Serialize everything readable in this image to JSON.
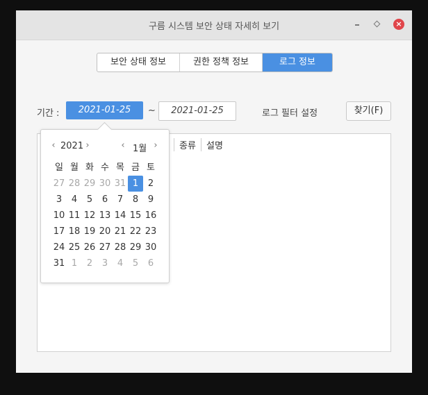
{
  "window": {
    "title": "구름 시스템 보안 상태 자세히 보기",
    "close_glyph": "×"
  },
  "tabs": [
    {
      "label": "보안 상태 정보",
      "active": false
    },
    {
      "label": "권한 정책 정보",
      "active": false
    },
    {
      "label": "로그 정보",
      "active": true
    }
  ],
  "filter": {
    "period_label": "기간 :",
    "start_date": "2021-01-25",
    "separator": "~",
    "end_date": "2021-01-25",
    "log_filter_label": "로그 필터 설정",
    "find_button": "찾기(F)"
  },
  "table": {
    "columns": [
      "종류",
      "설명"
    ]
  },
  "calendar": {
    "prev_arrow": "‹",
    "next_arrow": "›",
    "year": "2021",
    "month": "1월",
    "weekdays": [
      "일",
      "월",
      "화",
      "수",
      "목",
      "금",
      "토"
    ],
    "weeks": [
      [
        "27",
        "28",
        "29",
        "30",
        "31",
        "1",
        "2"
      ],
      [
        "3",
        "4",
        "5",
        "6",
        "7",
        "8",
        "9"
      ],
      [
        "10",
        "11",
        "12",
        "13",
        "14",
        "15",
        "16"
      ],
      [
        "17",
        "18",
        "19",
        "20",
        "21",
        "22",
        "23"
      ],
      [
        "24",
        "25",
        "26",
        "27",
        "28",
        "29",
        "30"
      ],
      [
        "31",
        "1",
        "2",
        "3",
        "4",
        "5",
        "6"
      ]
    ],
    "selected_day": "1",
    "accent_color": "#4a90e2"
  },
  "colors": {
    "accent": "#4a90e2",
    "close_button": "#e0454a"
  }
}
